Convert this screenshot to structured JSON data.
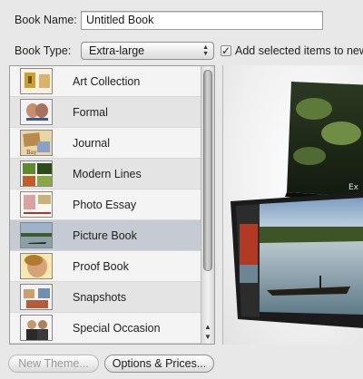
{
  "form": {
    "book_name_label": "Book Name:",
    "book_name_value": "Untitled Book",
    "book_type_label": "Book Type:",
    "book_type_value": "Extra-large",
    "add_selected_label": "Add selected items to new",
    "add_selected_checked": "✓"
  },
  "themes": [
    {
      "label": "Art Collection",
      "thumb_icon": "art-collection-thumbnail"
    },
    {
      "label": "Formal",
      "thumb_icon": "formal-thumbnail"
    },
    {
      "label": "Journal",
      "thumb_icon": "journal-thumbnail"
    },
    {
      "label": "Modern Lines",
      "thumb_icon": "modern-lines-thumbnail"
    },
    {
      "label": "Photo Essay",
      "thumb_icon": "photo-essay-thumbnail"
    },
    {
      "label": "Picture Book",
      "thumb_icon": "picture-book-thumbnail"
    },
    {
      "label": "Proof Book",
      "thumb_icon": "proof-book-thumbnail"
    },
    {
      "label": "Snapshots",
      "thumb_icon": "snapshots-thumbnail"
    },
    {
      "label": "Special Occasion",
      "thumb_icon": "special-occasion-thumbnail"
    }
  ],
  "selected_theme": "Picture Book",
  "buttons": {
    "new_theme": "New Theme...",
    "options_prices": "Options & Prices..."
  },
  "colors": {
    "selection": "#c6cbd3",
    "background": "#e8e8e8"
  }
}
